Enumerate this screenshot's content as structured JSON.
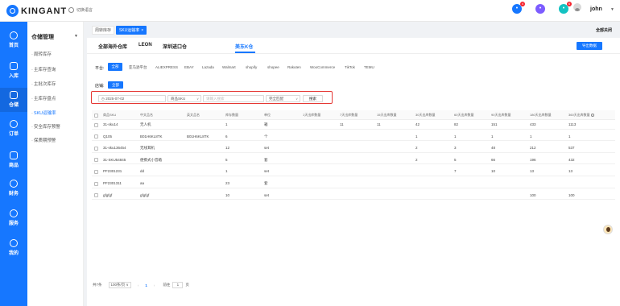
{
  "header": {
    "logo_text": "KINGANT",
    "language_label": "切换语言",
    "notification_badge": "4",
    "service_badge": "6",
    "username": "john"
  },
  "leftnav": [
    {
      "label": "首页",
      "icon": "home-icon"
    },
    {
      "label": "入库",
      "icon": "inbound-icon"
    },
    {
      "label": "仓储",
      "icon": "warehouse-icon"
    },
    {
      "label": "订单",
      "icon": "order-icon"
    },
    {
      "label": "商品",
      "icon": "product-icon"
    },
    {
      "label": "财务",
      "icon": "finance-icon"
    },
    {
      "label": "服务",
      "icon": "service-icon"
    },
    {
      "label": "我的",
      "icon": "user-icon"
    }
  ],
  "submenu": {
    "title": "仓储管理",
    "items": [
      "周转库存",
      "主库存查询",
      "主批次库存",
      "主库存盘点",
      "SKU运输率",
      "安全库存预警",
      "保质期预警"
    ]
  },
  "pagetabs": {
    "items": [
      "周转库存",
      "SKU运输率"
    ],
    "close_all": "全部关闭"
  },
  "warehouses": {
    "tabs": [
      "全部海外仓库",
      "LEON",
      "深圳进口仓",
      "美东K仓"
    ],
    "export_label": "导出数据"
  },
  "filters": {
    "platform_label": "平台:",
    "platform_all": "全部",
    "platforms": [
      "亚马逊平台",
      "ALIEXPRESS",
      "EBAY",
      "Lazada",
      "Walmart",
      "shopify",
      "shopee",
      "Rakuten",
      "WooCommerce",
      "TikTok",
      "TEMU"
    ],
    "shop_label": "店铺:",
    "shop_all": "全部",
    "date_value": "2025-07-02",
    "field_select": "商品SKU",
    "keyword_placeholder": "请输入搜索",
    "match_select": "完全匹配",
    "search_label": "搜索"
  },
  "table": {
    "headers": [
      "商品SKU",
      "中文品名",
      "英文品名",
      "库存数量",
      "单位",
      "1天出库数量",
      "7天出库数量",
      "15天出库数量",
      "30天出库数量",
      "60天出库数量",
      "90天出库数量",
      "180天出库数量",
      "360天出库数量"
    ],
    "rows": [
      [
        "31-sku14",
        "无人机",
        "",
        "1",
        "箱",
        "",
        "11",
        "11",
        "42",
        "82",
        "151",
        "433",
        "1113"
      ],
      [
        "Q105",
        "B01H6KL8TK",
        "B01H6KL8TK",
        "6",
        "个",
        "",
        "",
        "",
        "1",
        "1",
        "1",
        "1",
        "1"
      ],
      [
        "31-sku136454",
        "无线耳机",
        "",
        "12",
        "set",
        "",
        "",
        "",
        "2",
        "3",
        "48",
        "212",
        "537"
      ],
      [
        "31-SKU54845",
        "便携式小音箱",
        "",
        "5",
        "套",
        "",
        "",
        "",
        "2",
        "5",
        "66",
        "196",
        "432"
      ],
      [
        "PF2301231",
        "dd",
        "",
        "1",
        "set",
        "",
        "",
        "",
        "",
        "7",
        "10",
        "13",
        "13"
      ],
      [
        "PF2301311",
        "aa",
        "",
        "23",
        "套",
        "",
        "",
        "",
        "",
        "",
        "",
        "",
        ""
      ],
      [
        "gfgfgf",
        "gfgfgf",
        "",
        "10",
        "set",
        "",
        "",
        "",
        "",
        "",
        "",
        "100",
        "100"
      ]
    ]
  },
  "pagination": {
    "total": "共7条",
    "page_size": "100条/页",
    "current_page": "1",
    "goto_label": "前往",
    "goto_value": "1",
    "unit": "页"
  }
}
